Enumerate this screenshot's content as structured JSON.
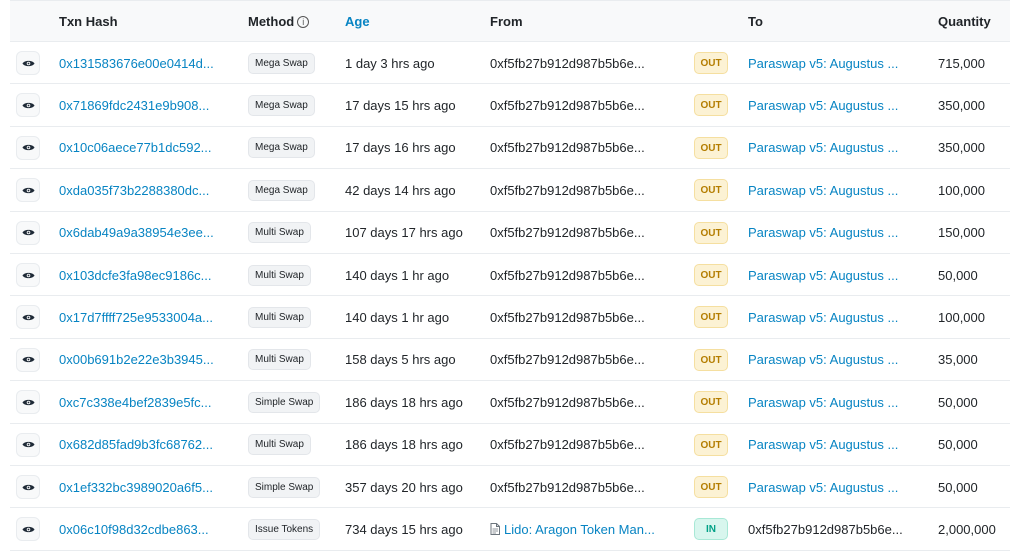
{
  "headers": {
    "txn_hash": "Txn Hash",
    "method": "Method",
    "method_info": "i",
    "age": "Age",
    "from": "From",
    "to": "To",
    "quantity": "Quantity"
  },
  "rows": [
    {
      "hash": "0x131583676e00e0414d...",
      "method": "Mega Swap",
      "age": "1 day 3 hrs ago",
      "from": "0xf5fb27b912d987b5b6e...",
      "direction": "OUT",
      "to": "Paraswap v5: Augustus ...",
      "quantity": "715,000"
    },
    {
      "hash": "0x71869fdc2431e9b908...",
      "method": "Mega Swap",
      "age": "17 days 15 hrs ago",
      "from": "0xf5fb27b912d987b5b6e...",
      "direction": "OUT",
      "to": "Paraswap v5: Augustus ...",
      "quantity": "350,000"
    },
    {
      "hash": "0x10c06aece77b1dc592...",
      "method": "Mega Swap",
      "age": "17 days 16 hrs ago",
      "from": "0xf5fb27b912d987b5b6e...",
      "direction": "OUT",
      "to": "Paraswap v5: Augustus ...",
      "quantity": "350,000"
    },
    {
      "hash": "0xda035f73b2288380dc...",
      "method": "Mega Swap",
      "age": "42 days 14 hrs ago",
      "from": "0xf5fb27b912d987b5b6e...",
      "direction": "OUT",
      "to": "Paraswap v5: Augustus ...",
      "quantity": "100,000"
    },
    {
      "hash": "0x6dab49a9a38954e3ee...",
      "method": "Multi Swap",
      "age": "107 days 17 hrs ago",
      "from": "0xf5fb27b912d987b5b6e...",
      "direction": "OUT",
      "to": "Paraswap v5: Augustus ...",
      "quantity": "150,000"
    },
    {
      "hash": "0x103dcfe3fa98ec9186c...",
      "method": "Multi Swap",
      "age": "140 days 1 hr ago",
      "from": "0xf5fb27b912d987b5b6e...",
      "direction": "OUT",
      "to": "Paraswap v5: Augustus ...",
      "quantity": "50,000"
    },
    {
      "hash": "0x17d7ffff725e9533004a...",
      "method": "Multi Swap",
      "age": "140 days 1 hr ago",
      "from": "0xf5fb27b912d987b5b6e...",
      "direction": "OUT",
      "to": "Paraswap v5: Augustus ...",
      "quantity": "100,000"
    },
    {
      "hash": "0x00b691b2e22e3b3945...",
      "method": "Multi Swap",
      "age": "158 days 5 hrs ago",
      "from": "0xf5fb27b912d987b5b6e...",
      "direction": "OUT",
      "to": "Paraswap v5: Augustus ...",
      "quantity": "35,000"
    },
    {
      "hash": "0xc7c338e4bef2839e5fc...",
      "method": "Simple Swap",
      "age": "186 days 18 hrs ago",
      "from": "0xf5fb27b912d987b5b6e...",
      "direction": "OUT",
      "to": "Paraswap v5: Augustus ...",
      "quantity": "50,000"
    },
    {
      "hash": "0x682d85fad9b3fc68762...",
      "method": "Multi Swap",
      "age": "186 days 18 hrs ago",
      "from": "0xf5fb27b912d987b5b6e...",
      "direction": "OUT",
      "to": "Paraswap v5: Augustus ...",
      "quantity": "50,000"
    },
    {
      "hash": "0x1ef332bc3989020a6f5...",
      "method": "Simple Swap",
      "age": "357 days 20 hrs ago",
      "from": "0xf5fb27b912d987b5b6e...",
      "direction": "OUT",
      "to": "Paraswap v5: Augustus ...",
      "quantity": "50,000"
    },
    {
      "hash": "0x06c10f98d32cdbe863...",
      "method": "Issue Tokens",
      "age": "734 days 15 hrs ago",
      "from": "Lido: Aragon Token Man...",
      "from_is_contract": true,
      "direction": "IN",
      "to": "0xf5fb27b912d987b5b6e...",
      "quantity": "2,000,000"
    }
  ],
  "colors": {
    "link": "#0784c3",
    "out_bg": "#fcf2d4",
    "out_text": "#b47d00",
    "in_bg": "#d8f6ee",
    "in_text": "#00a186",
    "header_bg": "#f8f9fa"
  },
  "icons": {
    "row_action": "eye-icon",
    "contract": "document-icon",
    "method_info": "info-circle-icon"
  }
}
